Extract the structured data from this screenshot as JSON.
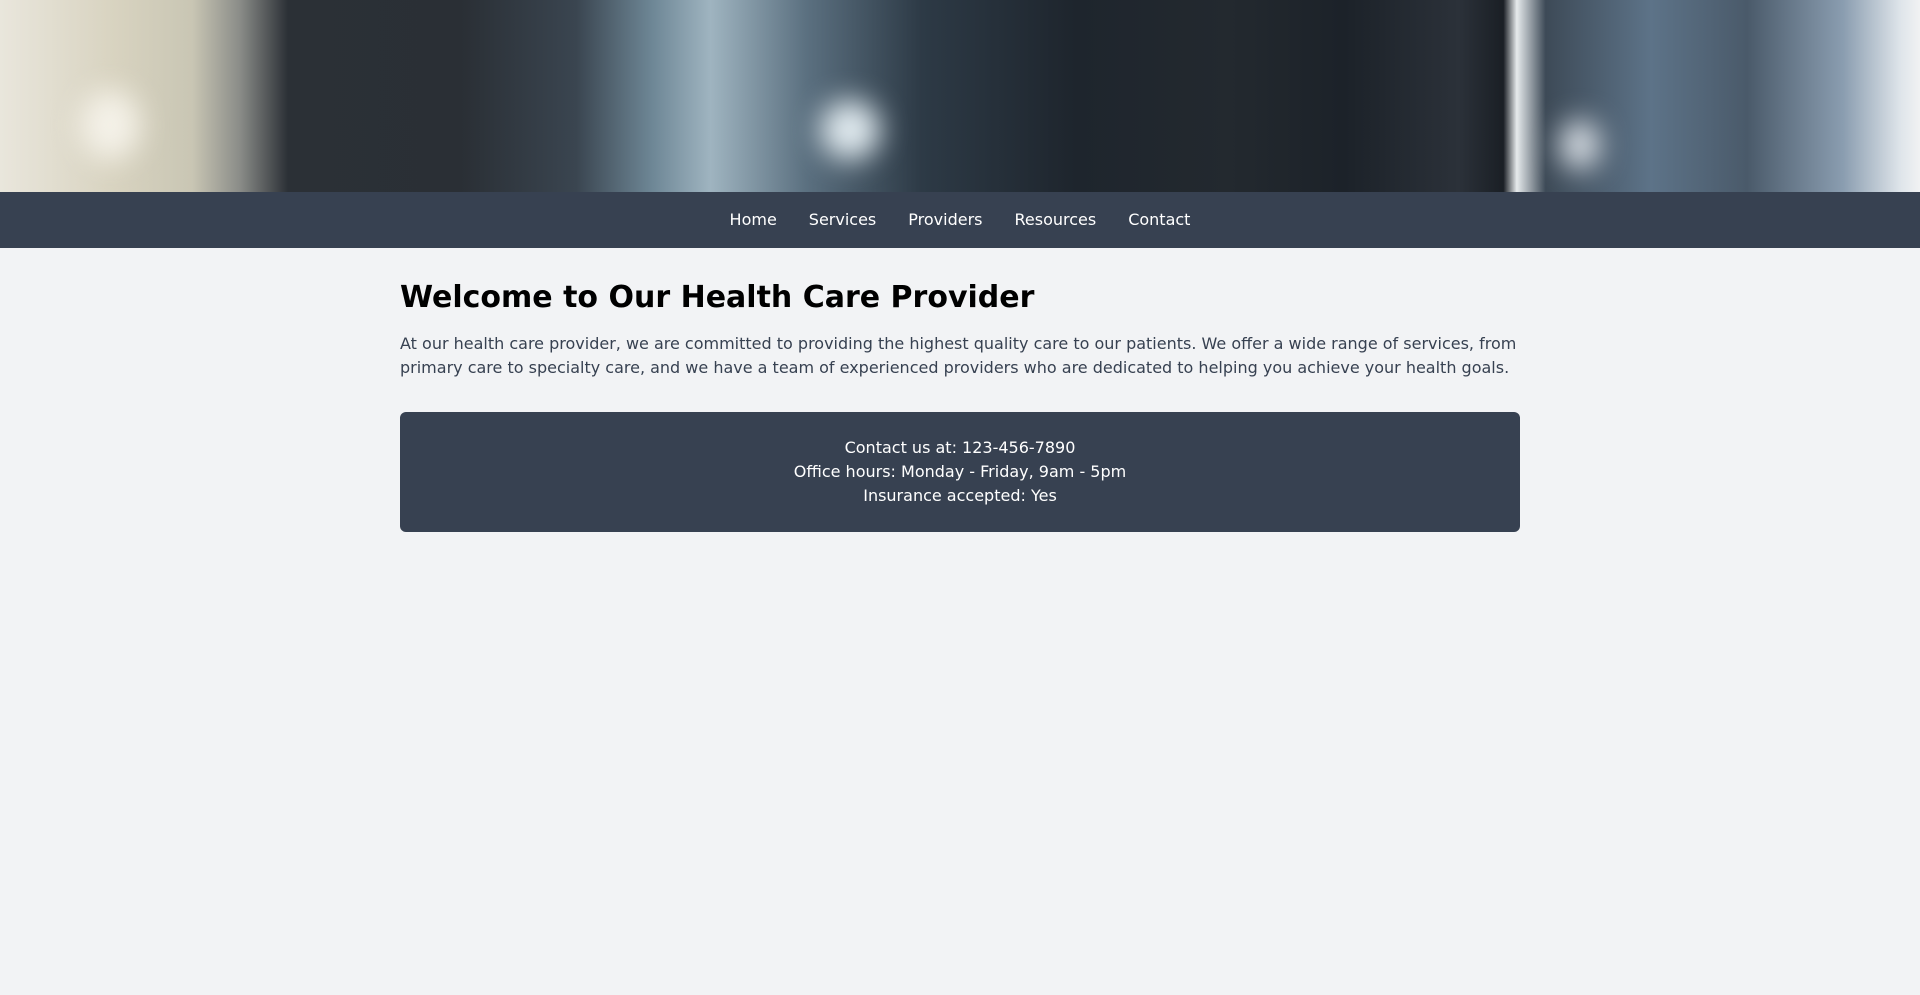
{
  "nav": {
    "items": [
      {
        "label": "Home"
      },
      {
        "label": "Services"
      },
      {
        "label": "Providers"
      },
      {
        "label": "Resources"
      },
      {
        "label": "Contact"
      }
    ]
  },
  "main": {
    "title": "Welcome to Our Health Care Provider",
    "intro": "At our health care provider, we are committed to providing the highest quality care to our patients. We offer a wide range of services, from primary care to specialty care, and we have a team of experienced providers who are dedicated to helping you achieve your health goals."
  },
  "info": {
    "contact": "Contact us at: 123-456-7890",
    "hours": "Office hours: Monday - Friday, 9am - 5pm",
    "insurance": "Insurance accepted: Yes"
  },
  "colors": {
    "nav_bg": "#374151",
    "page_bg": "#f2f3f5",
    "text_body": "#374151",
    "text_light": "#ffffff"
  }
}
